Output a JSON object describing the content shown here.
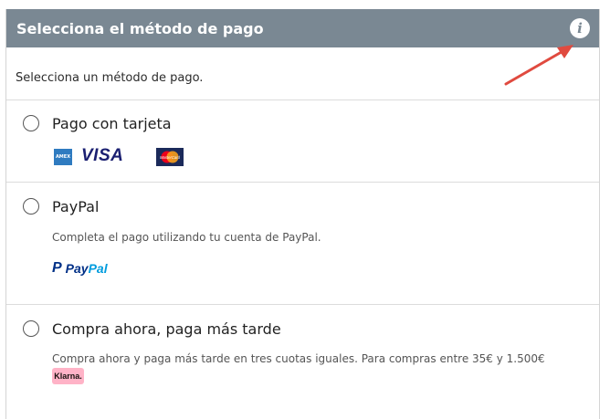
{
  "header": {
    "title": "Selecciona el método de pago",
    "info_icon": "i"
  },
  "intro": "Selecciona un método de pago.",
  "options": [
    {
      "title": "Pago con tarjeta",
      "logos": {
        "amex": "AMEX",
        "visa": "VISA",
        "mastercard": "MasterCard"
      }
    },
    {
      "title": "PayPal",
      "description": "Completa el pago utilizando tu cuenta de PayPal.",
      "logo": {
        "mark": "P",
        "word_a": "Pay",
        "word_b": "Pal"
      }
    },
    {
      "title": "Compra ahora, paga más tarde",
      "description": "Compra ahora y paga más tarde en tres cuotas iguales. Para compras entre 35€ y 1.500€",
      "logo": "Klarna."
    }
  ],
  "colors": {
    "header_bg": "#7a8893",
    "arrow": "#e04a3f",
    "klarna": "#ffb3c7",
    "paypal": "#003087"
  }
}
